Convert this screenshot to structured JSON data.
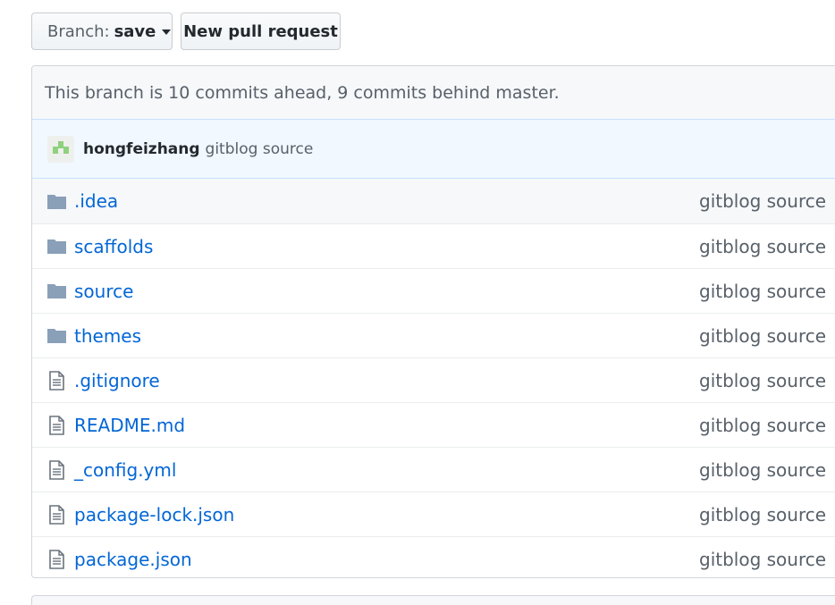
{
  "toolbar": {
    "branch_prefix": "Branch:",
    "branch_value": "save",
    "new_pr_label": "New pull request"
  },
  "branch_status": "This branch is 10 commits ahead, 9 commits behind master.",
  "latest_commit": {
    "author": "hongfeizhang",
    "message": "gitblog source"
  },
  "files": [
    {
      "name": ".idea",
      "type": "folder",
      "message": "gitblog source"
    },
    {
      "name": "scaffolds",
      "type": "folder",
      "message": "gitblog source"
    },
    {
      "name": "source",
      "type": "folder",
      "message": "gitblog source"
    },
    {
      "name": "themes",
      "type": "folder",
      "message": "gitblog source"
    },
    {
      "name": ".gitignore",
      "type": "file",
      "message": "gitblog source"
    },
    {
      "name": "README.md",
      "type": "file",
      "message": "gitblog source"
    },
    {
      "name": "_config.yml",
      "type": "file",
      "message": "gitblog source"
    },
    {
      "name": "package-lock.json",
      "type": "file",
      "message": "gitblog source"
    },
    {
      "name": "package.json",
      "type": "file",
      "message": "gitblog source"
    }
  ],
  "colors": {
    "link": "#0366d6",
    "muted": "#586069",
    "folder": "#79b8ff",
    "icon_folder": "#8a9fb8",
    "icon_file": "#6a737d"
  },
  "icons": {
    "folder": "folder-icon",
    "file": "file-icon",
    "caret": "caret-down-icon"
  }
}
